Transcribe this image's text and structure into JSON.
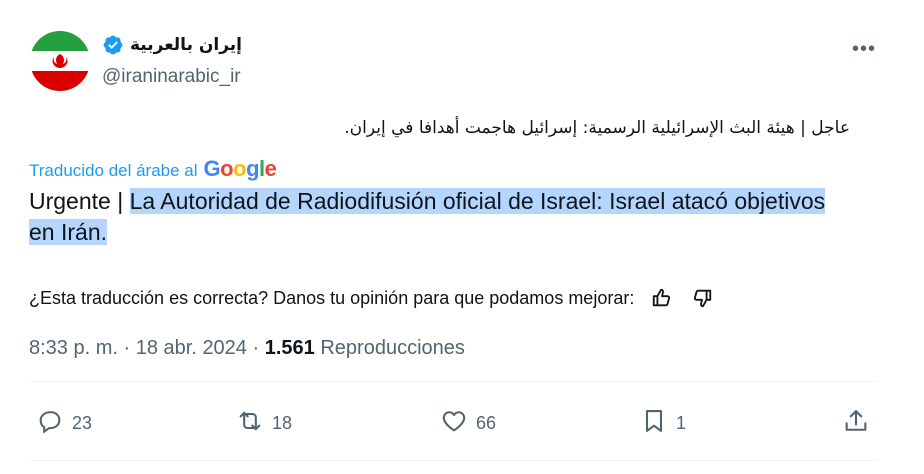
{
  "author": {
    "display_name": "إيران بالعربية",
    "handle": "@iraninarabic_ir"
  },
  "tweet": {
    "original_text": "عاجل | هيئة البث الإسرائيلية الرسمية: إسرائيل هاجمت أهدافا في إيران.",
    "translated_by_label": "Traducido del árabe al",
    "google_label": "Google",
    "translation_prefix": "Urgente | ",
    "translation_highlighted": "La Autoridad de Radiodifusión oficial de Israel: Israel atacó objetivos en Irán.",
    "feedback_question": "¿Esta traducción es correcta? Danos tu opinión para que podamos mejorar:",
    "time": "8:33 p. m.",
    "sep1": " · ",
    "date": "18 abr. 2024",
    "sep2": " · ",
    "views_count": "1.561",
    "views_label": "Reproducciones"
  },
  "actions": {
    "replies": "23",
    "reposts": "18",
    "likes": "66",
    "bookmarks": "1"
  },
  "colors": {
    "accent": "#1d9bf0",
    "secondary_text": "#536471",
    "highlight": "#b4d5fe"
  },
  "icons": [
    "avatar-flag-iran",
    "verified-badge-icon",
    "more-icon",
    "thumbs-up-icon",
    "thumbs-down-icon",
    "reply-icon",
    "repost-icon",
    "like-icon",
    "bookmark-icon",
    "share-icon"
  ]
}
